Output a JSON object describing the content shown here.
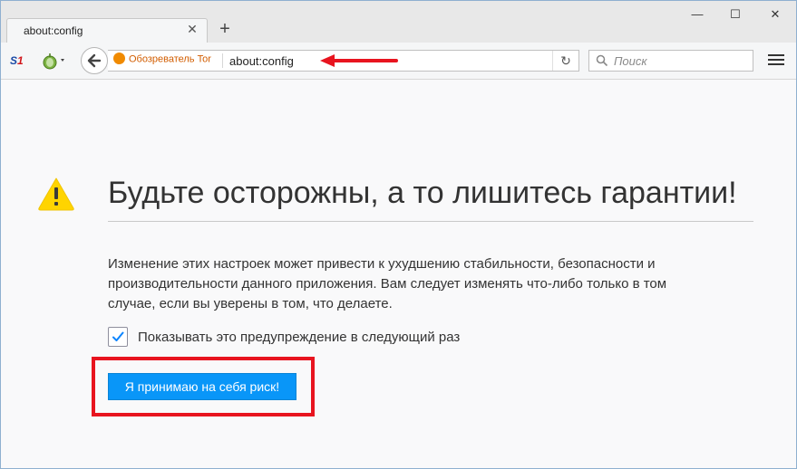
{
  "browser": {
    "tab_title": "about:config",
    "tab_close": "✕",
    "new_tab": "+",
    "window_controls": {
      "minimize": "—",
      "maximize": "☐",
      "close": "✕"
    }
  },
  "toolbar": {
    "extension_s1": {
      "text_s": "S",
      "text_1": "1"
    },
    "identity_label": "Обозреватель Tor",
    "url": "about:config",
    "reload": "↻",
    "search_placeholder": "Поиск"
  },
  "warning": {
    "heading": "Будьте осторожны, а то лишитесь гарантии!",
    "body": "Изменение этих настроек может привести к ухудшению стабильности, безопасности и производительности данного приложения. Вам следует изменять что-либо только в том случае, если вы уверены в том, что делаете.",
    "checkbox_label": "Показывать это предупреждение в следующий раз",
    "checkbox_checked": true,
    "accept_button": "Я принимаю на себя риск!"
  },
  "colors": {
    "accent_button": "#0996f8",
    "highlight_red": "#e8141f",
    "warning_yellow": "#ffd400",
    "identity_orange": "#d25d00"
  },
  "icons": [
    "back-arrow-icon",
    "tor-onion-icon",
    "reload-icon",
    "search-icon",
    "hamburger-menu-icon",
    "warning-triangle-icon",
    "checkmark-icon"
  ]
}
